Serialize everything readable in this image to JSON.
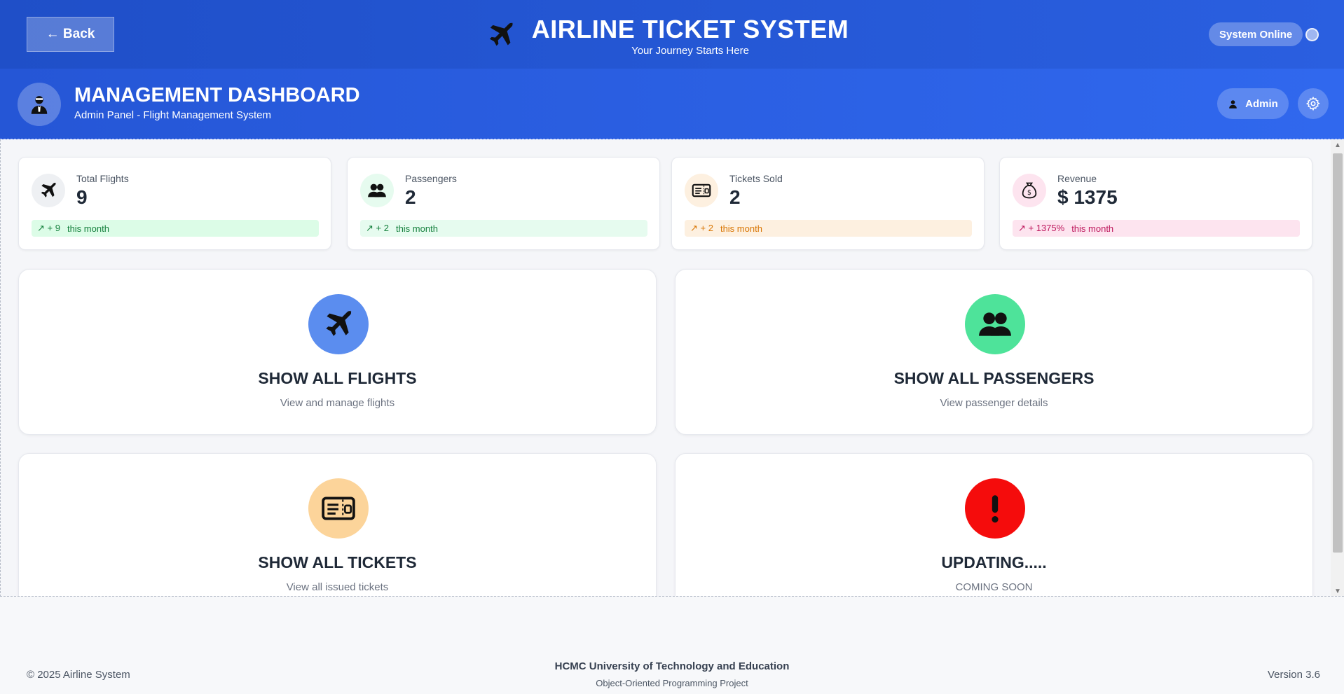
{
  "header": {
    "back_label": "← Back",
    "title": "AIRLINE TICKET SYSTEM",
    "subtitle": "Your Journey Starts Here",
    "status": "System Online"
  },
  "dashboard": {
    "title": "MANAGEMENT DASHBOARD",
    "subtitle": "Admin Panel - Flight Management System",
    "admin_label": "Admin"
  },
  "stats": [
    {
      "label": "Total Flights",
      "value": "9",
      "trend": "↗ + 9",
      "period": "this month",
      "icon": "airplane-icon"
    },
    {
      "label": "Passengers",
      "value": "2",
      "trend": "↗ + 2",
      "period": "this month",
      "icon": "users-icon"
    },
    {
      "label": "Tickets Sold",
      "value": "2",
      "trend": "↗ + 2",
      "period": "this month",
      "icon": "ticket-icon"
    },
    {
      "label": "Revenue",
      "value": "$ 1375",
      "trend": "↗ + 1375%",
      "period": "this month",
      "icon": "money-bag-icon"
    }
  ],
  "actions": [
    {
      "title": "SHOW ALL FLIGHTS",
      "desc": "View and manage flights",
      "color": "#5b8def",
      "icon": "airplane-icon"
    },
    {
      "title": "SHOW ALL PASSENGERS",
      "desc": "View passenger details",
      "color": "#4ee39a",
      "icon": "users-icon"
    },
    {
      "title": "SHOW ALL TICKETS",
      "desc": "View all issued tickets",
      "color": "#fcd49a",
      "icon": "ticket-icon"
    },
    {
      "title": "UPDATING.....",
      "desc": "COMING SOON",
      "color": "#f50c0c",
      "icon": "exclamation-icon"
    }
  ],
  "footer": {
    "copyright": "© 2025 Airline System",
    "university": "HCMC University of Technology and Education",
    "project": "Object-Oriented Programming Project",
    "version": "Version 3.6"
  },
  "colors": {
    "header_start": "#1f4fc8",
    "header_end": "#2a5fe0",
    "trend_green_bg": "#dcfce7",
    "trend_green_fg": "#15803d",
    "trend_teal_bg": "#e6fbef",
    "trend_orange_bg": "#fdf0e0",
    "trend_orange_fg": "#d97706",
    "trend_pink_bg": "#fde4ef",
    "trend_pink_fg": "#be185d"
  }
}
